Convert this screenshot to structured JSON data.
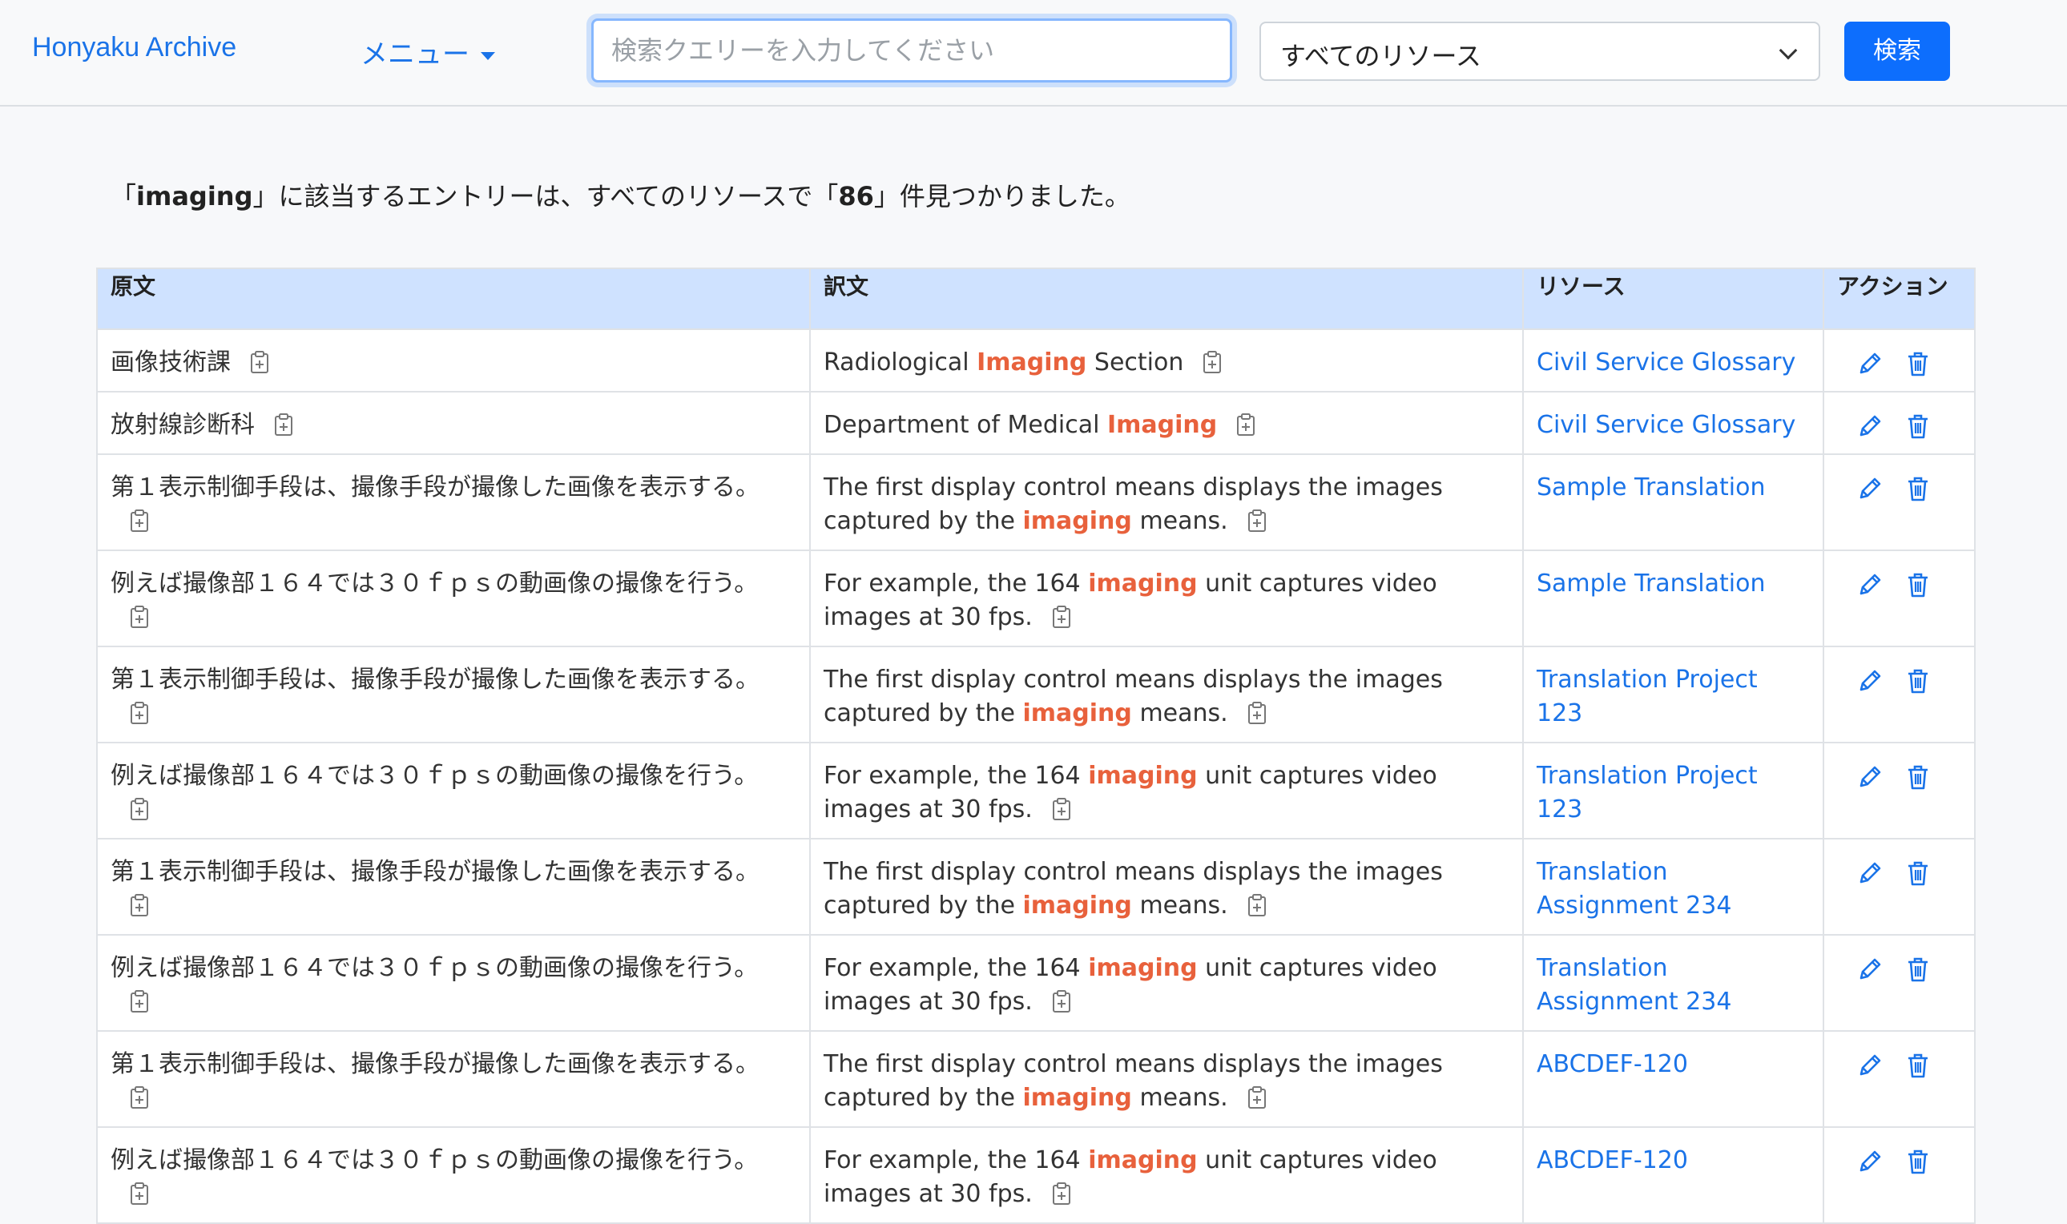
{
  "header": {
    "brand": "Honyaku Archive",
    "menu_label": "メニュー",
    "search_placeholder": "検索クエリーを入力してください",
    "resource_select_value": "すべてのリソース",
    "search_button": "検索"
  },
  "summary": {
    "prefix": "「",
    "query": "imaging",
    "middle": "」に該当するエントリーは、すべてのリソースで「",
    "count": "86",
    "suffix": "」件見つかりました。"
  },
  "table": {
    "headers": [
      "原文",
      "訳文",
      "リソース",
      "アクション"
    ],
    "rows": [
      {
        "source": "画像技術課",
        "target_before": "Radiological ",
        "target_hl": "Imaging",
        "target_after": " Section",
        "resource": "Civil Service Glossary"
      },
      {
        "source": "放射線診断科",
        "target_before": "Department of Medical ",
        "target_hl": "Imaging",
        "target_after": "",
        "resource": "Civil Service Glossary"
      },
      {
        "source": "第１表示制御手段は、撮像手段が撮像した画像を表示する。",
        "target_before": "The first display control means displays the images captured by the ",
        "target_hl": "imaging",
        "target_after": " means.",
        "resource": "Sample Translation"
      },
      {
        "source": "例えば撮像部１６４では３０ｆｐｓの動画像の撮像を行う。",
        "target_before": "For example, the 164 ",
        "target_hl": "imaging",
        "target_after": " unit captures video images at 30 fps.",
        "resource": "Sample Translation"
      },
      {
        "source": "第１表示制御手段は、撮像手段が撮像した画像を表示する。",
        "target_before": "The first display control means displays the images captured by the ",
        "target_hl": "imaging",
        "target_after": " means.",
        "resource": "Translation Project 123"
      },
      {
        "source": "例えば撮像部１６４では３０ｆｐｓの動画像の撮像を行う。",
        "target_before": "For example, the 164 ",
        "target_hl": "imaging",
        "target_after": " unit captures video images at 30 fps.",
        "resource": "Translation Project 123"
      },
      {
        "source": "第１表示制御手段は、撮像手段が撮像した画像を表示する。",
        "target_before": "The first display control means displays the images captured by the ",
        "target_hl": "imaging",
        "target_after": " means.",
        "resource": "Translation Assignment 234"
      },
      {
        "source": "例えば撮像部１６４では３０ｆｐｓの動画像の撮像を行う。",
        "target_before": "For example, the 164 ",
        "target_hl": "imaging",
        "target_after": " unit captures video images at 30 fps.",
        "resource": "Translation Assignment 234"
      },
      {
        "source": "第１表示制御手段は、撮像手段が撮像した画像を表示する。",
        "target_before": "The first display control means displays the images captured by the ",
        "target_hl": "imaging",
        "target_after": " means.",
        "resource": "ABCDEF-120"
      },
      {
        "source": "例えば撮像部１６４では３０ｆｐｓの動画像の撮像を行う。",
        "target_before": "For example, the 164 ",
        "target_hl": "imaging",
        "target_after": " unit captures video images at 30 fps.",
        "resource": "ABCDEF-120"
      }
    ]
  },
  "icons": {
    "copy": "clipboard-plus-icon",
    "edit": "pencil-icon",
    "delete": "trash-icon"
  },
  "colors": {
    "accent": "#1a73e8",
    "highlight": "#e8613c",
    "header_bg": "#cfe2ff",
    "button": "#0d6efd"
  }
}
